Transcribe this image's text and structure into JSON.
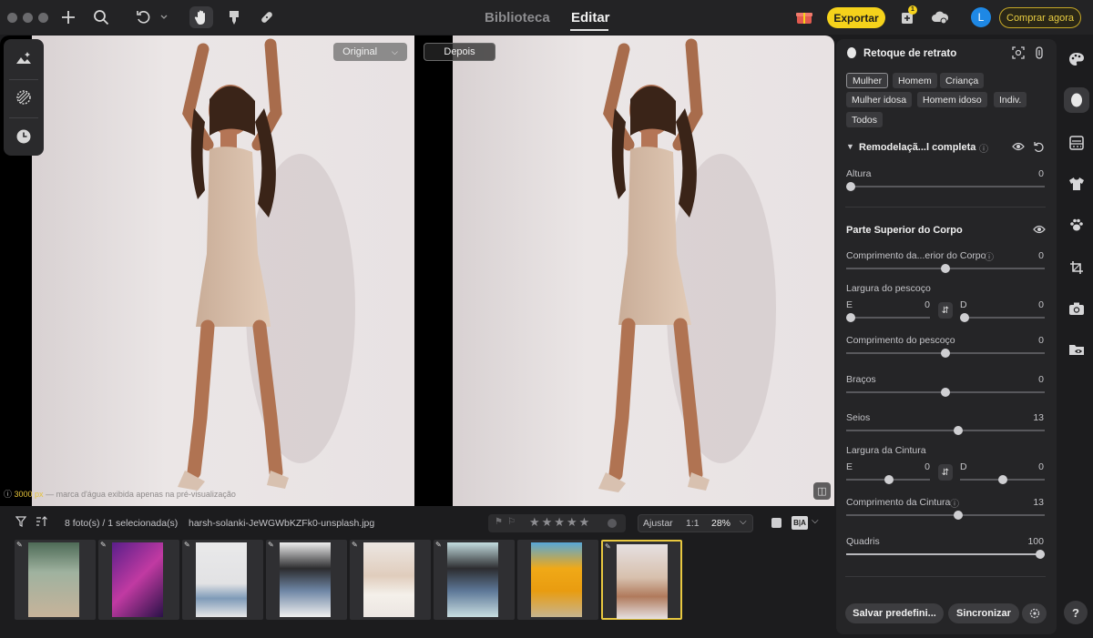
{
  "topbar": {
    "tabs": [
      {
        "label": "Biblioteca",
        "active": false
      },
      {
        "label": "Editar",
        "active": true
      }
    ],
    "export_label": "Exportar",
    "buy_label": "Comprar agora",
    "avatar_initial": "L",
    "notification_count": "1",
    "icons": [
      "plus-icon",
      "search-icon",
      "undo-icon",
      "hand-icon",
      "brush-icon",
      "bandage-icon",
      "gift-icon",
      "add-photo-icon",
      "cloud-sync-icon"
    ]
  },
  "canvas": {
    "before_label": "Original",
    "after_label": "Depois",
    "watermark_highlight": "3000 px",
    "watermark_text": "— marca d'água exibida apenas na pré-visualização"
  },
  "panel": {
    "title": "Retoque de retrato",
    "presets": [
      "Mulher",
      "Homem",
      "Criança",
      "Mulher idosa",
      "Homem idoso",
      "Indiv.",
      "Todos"
    ],
    "selected_preset": "Mulher",
    "section1": {
      "title": "Remodelaçã...l completa",
      "sliders": [
        {
          "label": "Altura",
          "value": "0"
        }
      ]
    },
    "section2": {
      "title": "Parte Superior do Corpo",
      "sliders": [
        {
          "label": "Comprimento da...erior do Corpo",
          "value": "0"
        },
        {
          "label": "Largura do pescoço",
          "left_label": "E",
          "left_value": "0",
          "right_label": "D",
          "right_value": "0"
        },
        {
          "label": "Comprimento do pescoço",
          "value": "0"
        },
        {
          "label": "Braços",
          "value": "0"
        },
        {
          "label": "Seios",
          "value": "13"
        },
        {
          "label": "Largura da Cintura",
          "left_label": "E",
          "left_value": "0",
          "right_label": "D",
          "right_value": "0"
        },
        {
          "label": "Comprimento da Cintura",
          "value": "13"
        },
        {
          "label": "Quadris",
          "value": "100"
        }
      ]
    },
    "save_preset_label": "Salvar predefini...",
    "sync_label": "Sincronizar"
  },
  "rail": {
    "icons": [
      "palette-icon",
      "portrait-icon",
      "texture-icon",
      "shirt-icon",
      "paw-icon",
      "crop-icon",
      "camera-icon",
      "folder-eye-icon"
    ],
    "help_label": "?"
  },
  "filmstrip": {
    "count_text": "8 foto(s) / 1 selecionada(s)",
    "filename": "harsh-solanki-JeWGWbKZFk0-unsplash.jpg",
    "fit_label": "Ajustar",
    "one_to_one_label": "1:1",
    "zoom_value": "28%",
    "compare_label": "B|A",
    "thumbnails": [
      {
        "name": "thumb-1",
        "selected": false
      },
      {
        "name": "thumb-2",
        "selected": false
      },
      {
        "name": "thumb-3",
        "selected": false
      },
      {
        "name": "thumb-4",
        "selected": false
      },
      {
        "name": "thumb-5",
        "selected": false
      },
      {
        "name": "thumb-6",
        "selected": false
      },
      {
        "name": "thumb-7",
        "selected": false
      },
      {
        "name": "thumb-8",
        "selected": true
      }
    ]
  },
  "colors": {
    "accent_yellow": "#f5d21b",
    "avatar_blue": "#1e88e5",
    "panel_bg": "#252527"
  }
}
